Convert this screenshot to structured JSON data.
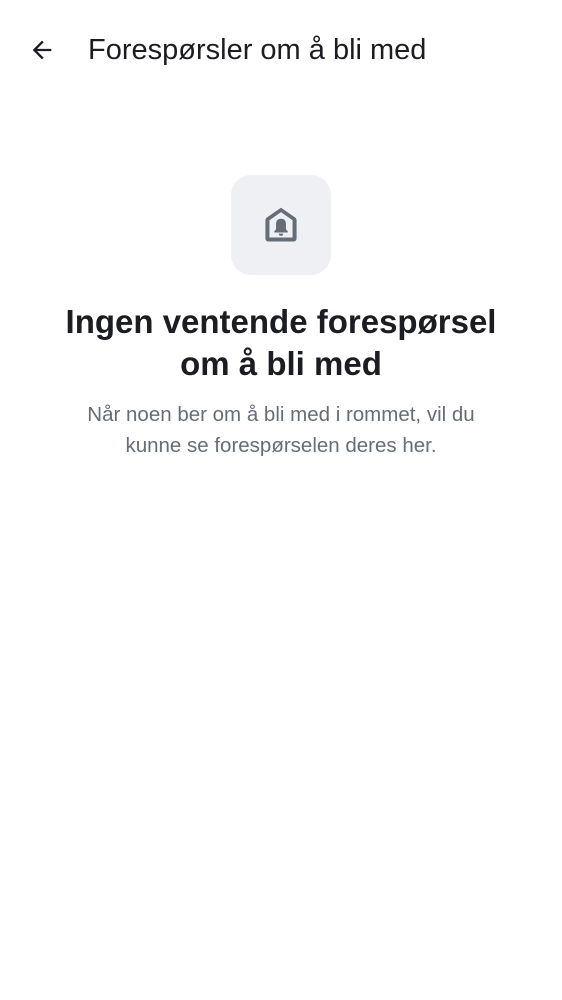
{
  "header": {
    "back_icon": "arrow-left-icon",
    "title": "Forespørsler om å bli med"
  },
  "empty_state": {
    "icon": "house-bell-icon",
    "title": "Ingen ventende forespørsel om å bli med",
    "subtitle": "Når noen ber om å bli med i rommet, vil du kunne se forespørselen deres her."
  },
  "colors": {
    "background": "#ffffff",
    "text_primary": "#1b1d22",
    "text_secondary": "#656d77",
    "icon_tile": "#eff0f4",
    "icon": "#656d77"
  }
}
